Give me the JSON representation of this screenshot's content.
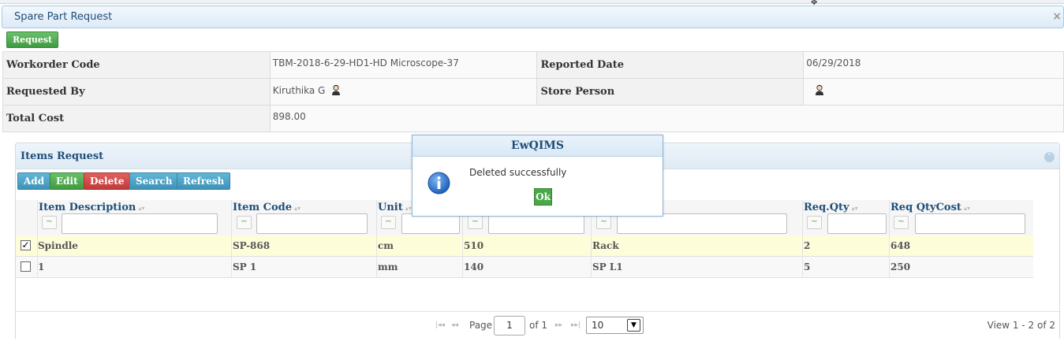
{
  "panel": {
    "title": "Spare Part Request",
    "close_glyph": "×"
  },
  "toolbar": {
    "request_label": "Request"
  },
  "info": {
    "workorder_code_label": "Workorder Code",
    "workorder_code_value": "TBM-2018-6-29-HD1-HD Microscope-37",
    "reported_date_label": "Reported Date",
    "reported_date_value": "06/29/2018",
    "requested_by_label": "Requested By",
    "requested_by_value": "Kiruthika G",
    "store_person_label": "Store Person",
    "store_person_value": "",
    "total_cost_label": "Total Cost",
    "total_cost_value": "898.00"
  },
  "items": {
    "title": "Items Request",
    "buttons": {
      "add": "Add",
      "edit": "Edit",
      "delete": "Delete",
      "search": "Search",
      "refresh": "Refresh"
    },
    "columns": [
      "Item Description",
      "Item Code",
      "Unit",
      "",
      "",
      "Req.Qty",
      "Req QtyCost"
    ],
    "rows": [
      {
        "selected": true,
        "cells": [
          "Spindle",
          "SP-868",
          "cm",
          "510",
          "Rack",
          "2",
          "648"
        ]
      },
      {
        "selected": false,
        "cells": [
          "1",
          "SP 1",
          "mm",
          "140",
          "SP L1",
          "5",
          "250"
        ]
      }
    ]
  },
  "pager": {
    "page_label": "Page",
    "page_value": "1",
    "of_label": "of 1",
    "rows_per_page": "10",
    "view_text": "View 1 - 2 of 2"
  },
  "dialog": {
    "title": "EwQIMS",
    "message": "Deleted successfully",
    "ok_label": "Ok"
  },
  "colors": {
    "accent_text": "#1f4e79",
    "green": "#3f9b3f",
    "blue": "#3d92b8",
    "red": "#c23a3a",
    "selected_row": "#fdfdda"
  },
  "icons": [
    "person-icon",
    "info-icon",
    "collapse-icon",
    "close-icon",
    "sort-icon",
    "filter-operator-icon",
    "first-page-icon",
    "prev-page-icon",
    "next-page-icon",
    "last-page-icon",
    "dropdown-arrow-icon"
  ]
}
